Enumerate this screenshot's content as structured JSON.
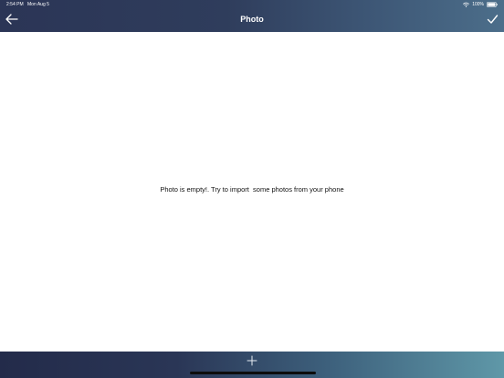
{
  "status_bar": {
    "time": "2:54 PM",
    "date": "Mon Aug 5",
    "battery": "100%"
  },
  "nav": {
    "title": "Photo",
    "back_icon": "arrow-left-icon",
    "confirm_icon": "checkmark-icon"
  },
  "content": {
    "empty_message": "Photo is empty!. Try to import  some photos from your phone"
  },
  "footer": {
    "add_icon": "plus-icon"
  },
  "colors": {
    "header_start": "#2b3556",
    "header_end": "#4c6e8a",
    "footer_start": "#232b4a",
    "footer_end": "#5f98a8",
    "text": "#111111",
    "icon": "#ffffff"
  }
}
